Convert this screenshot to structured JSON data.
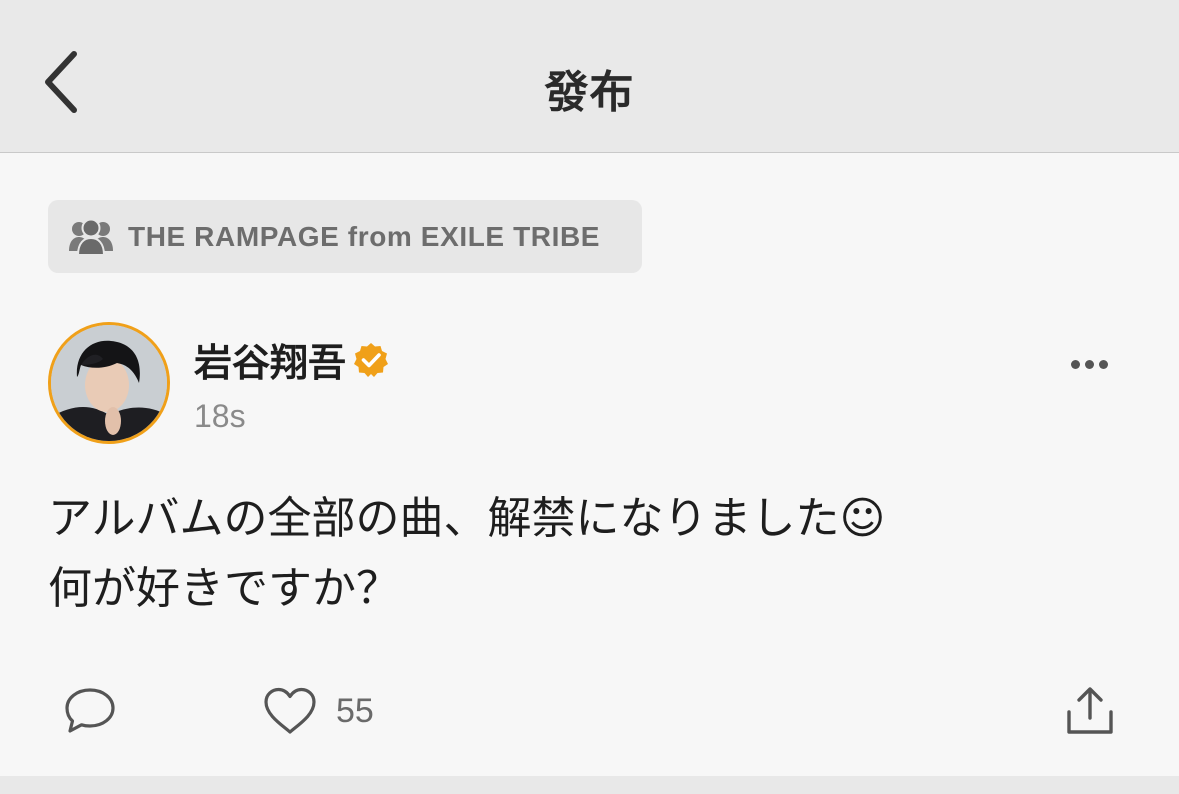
{
  "nav": {
    "title": "發布",
    "back_icon": "chevron-left-icon"
  },
  "group": {
    "icon": "group-people-icon",
    "label": "THE RAMPAGE from EXILE TRIBE"
  },
  "post": {
    "author": "岩谷翔吾",
    "verified_icon": "verified-badge-icon",
    "timestamp": "18s",
    "body": "アルバムの全部の曲、解禁になりました☺︎\n何が好きですか？",
    "more_icon": "more-dots-icon"
  },
  "actions": {
    "comment_icon": "comment-bubble-icon",
    "like_icon": "heart-icon",
    "like_count": "55",
    "share_icon": "share-upload-icon"
  },
  "colors": {
    "accent": "#f0a019",
    "header_bg": "#e9e9e9",
    "page_bg": "#f7f7f7",
    "icon_gray": "#555555"
  }
}
